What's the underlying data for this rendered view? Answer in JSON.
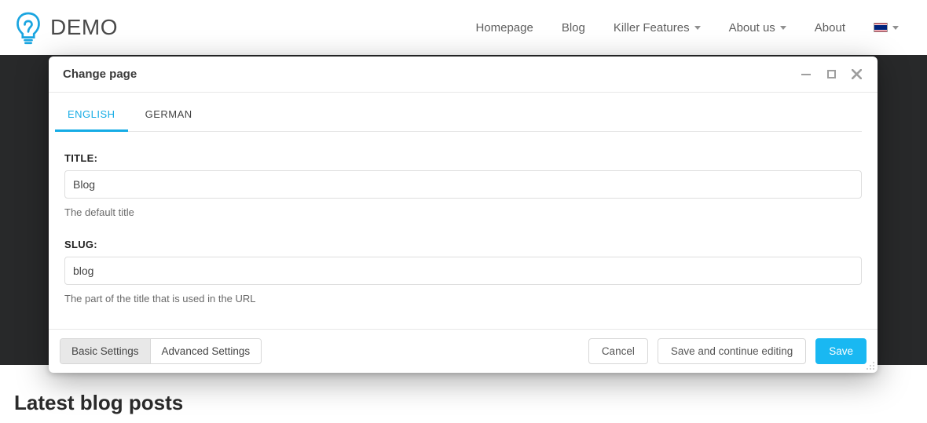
{
  "brand": {
    "name": "DEMO"
  },
  "nav": {
    "items": [
      {
        "label": "Homepage",
        "has_caret": false
      },
      {
        "label": "Blog",
        "has_caret": false
      },
      {
        "label": "Killer Features",
        "has_caret": true
      },
      {
        "label": "About us",
        "has_caret": true
      },
      {
        "label": "About",
        "has_caret": false
      }
    ],
    "language_flag": "en-gb"
  },
  "modal": {
    "title": "Change page",
    "language_tabs": [
      {
        "label": "ENGLISH",
        "active": true
      },
      {
        "label": "GERMAN",
        "active": false
      }
    ],
    "fields": {
      "title": {
        "label": "TITLE:",
        "value": "Blog",
        "help": "The default title"
      },
      "slug": {
        "label": "SLUG:",
        "value": "blog",
        "help": "The part of the title that is used in the URL"
      }
    },
    "footer_tabs": [
      {
        "label": "Basic Settings",
        "active": true
      },
      {
        "label": "Advanced Settings",
        "active": false
      }
    ],
    "actions": {
      "cancel": "Cancel",
      "save_continue": "Save and continue editing",
      "save": "Save"
    }
  },
  "page": {
    "section_heading": "Latest blog posts"
  },
  "colors": {
    "accent": "#15ace5",
    "primary_button": "#19b8f2"
  }
}
